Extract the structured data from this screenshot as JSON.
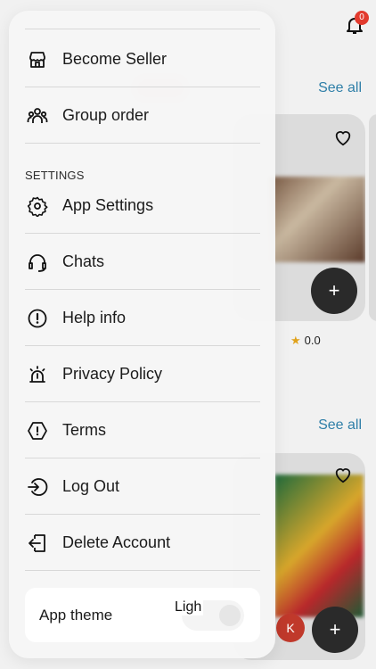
{
  "background": {
    "notification_count": "0",
    "see_all_label": "See all",
    "rating": "0.0",
    "avatar_letter": "K",
    "plus_symbol": "+"
  },
  "drawer": {
    "items_top": [
      {
        "label": "Become Seller",
        "icon": "store-icon"
      },
      {
        "label": "Group order",
        "icon": "group-icon"
      }
    ],
    "section_title": "SETTINGS",
    "items_settings": [
      {
        "label": "App Settings",
        "icon": "gear-icon"
      },
      {
        "label": "Chats",
        "icon": "headset-icon"
      },
      {
        "label": "Help info",
        "icon": "info-circle-icon"
      },
      {
        "label": "Privacy Policy",
        "icon": "alarm-light-icon"
      },
      {
        "label": "Terms",
        "icon": "hexagon-alert-icon"
      },
      {
        "label": "Log Out",
        "icon": "logout-icon"
      },
      {
        "label": "Delete Account",
        "icon": "exit-door-icon"
      }
    ],
    "app_theme": {
      "label": "App theme",
      "value": "Ligh"
    }
  }
}
